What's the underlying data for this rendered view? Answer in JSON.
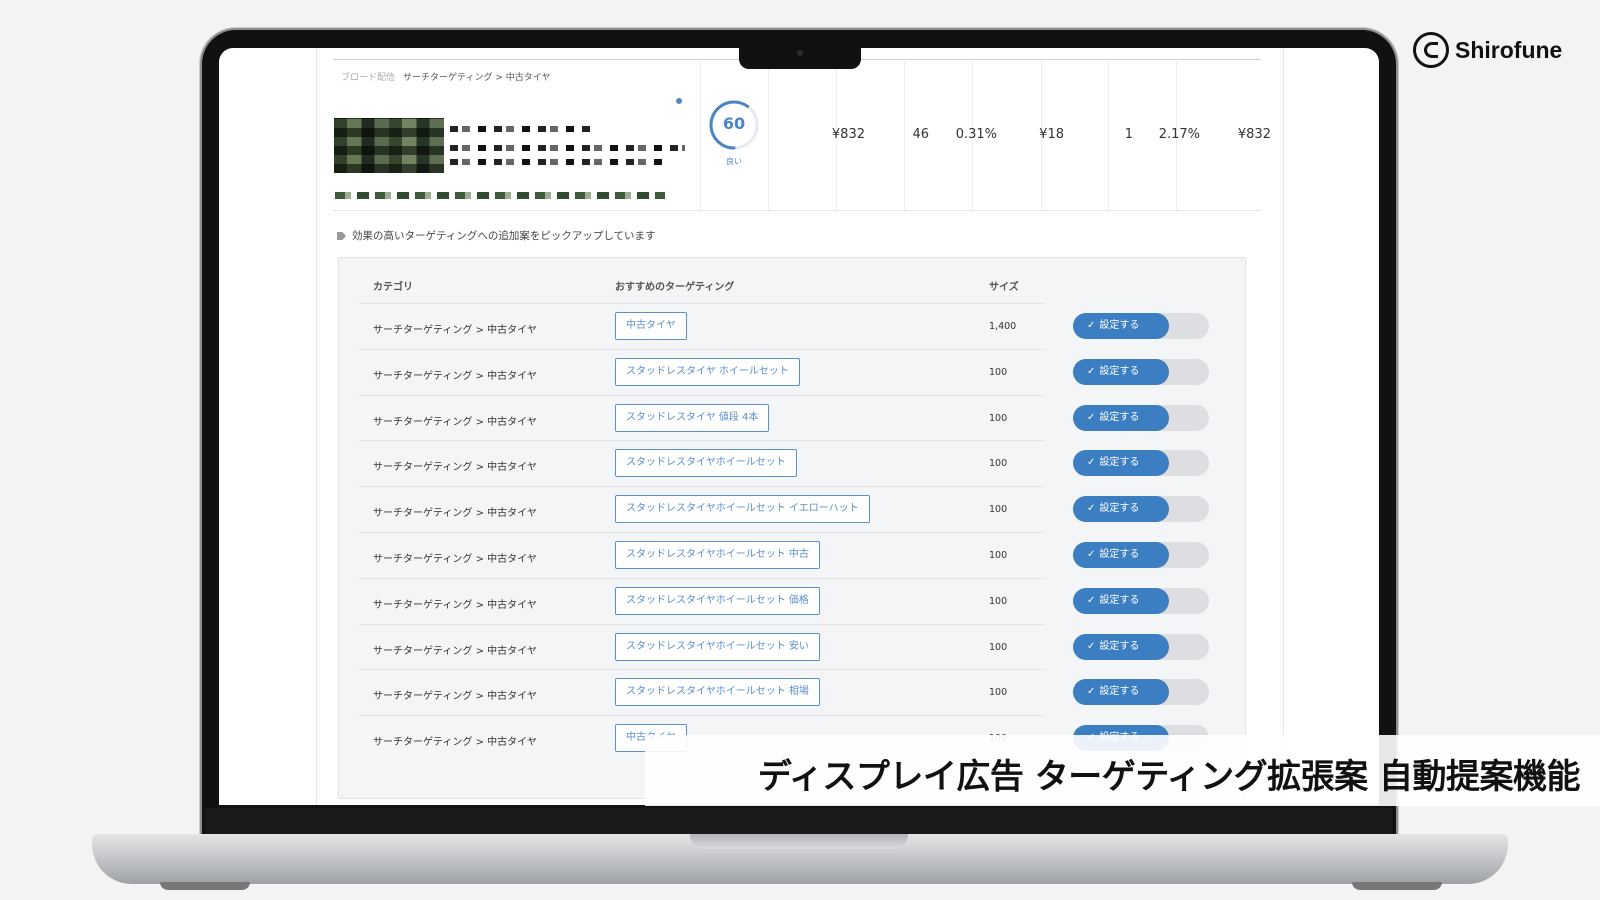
{
  "brand": {
    "name": "Shirofune",
    "logo_icon": "shirofune-logo-icon"
  },
  "caption": "ディスプレイ広告 ターゲティング拡張案 自動提案機能",
  "ad_row": {
    "delivery_label": "ブロード配信",
    "targeting_path": "サーチターゲティング > 中古タイヤ",
    "score": "60",
    "score_label": "良い",
    "metrics": [
      "¥832",
      "46",
      "0.31%",
      "¥18",
      "1",
      "2.17%",
      "¥832"
    ]
  },
  "suggestion_note": "効果の高いターゲティングへの追加案をピックアップしています",
  "table": {
    "headers": {
      "category": "カテゴリ",
      "targeting": "おすすめのターゲティング",
      "size": "サイズ"
    },
    "rows": [
      {
        "category": "サーチターゲティング > 中古タイヤ",
        "keyword": "中古タイヤ",
        "size": "1,400",
        "action": "設定する"
      },
      {
        "category": "サーチターゲティング > 中古タイヤ",
        "keyword": "スタッドレスタイヤ ホイールセット",
        "size": "100",
        "action": "設定する"
      },
      {
        "category": "サーチターゲティング > 中古タイヤ",
        "keyword": "スタッドレスタイヤ 値段 4本",
        "size": "100",
        "action": "設定する"
      },
      {
        "category": "サーチターゲティング > 中古タイヤ",
        "keyword": "スタッドレスタイヤホイールセット",
        "size": "100",
        "action": "設定する"
      },
      {
        "category": "サーチターゲティング > 中古タイヤ",
        "keyword": "スタッドレスタイヤホイールセット イエローハット",
        "size": "100",
        "action": "設定する"
      },
      {
        "category": "サーチターゲティング > 中古タイヤ",
        "keyword": "スタッドレスタイヤホイールセット 中古",
        "size": "100",
        "action": "設定する"
      },
      {
        "category": "サーチターゲティング > 中古タイヤ",
        "keyword": "スタッドレスタイヤホイールセット 価格",
        "size": "100",
        "action": "設定する"
      },
      {
        "category": "サーチターゲティング > 中古タイヤ",
        "keyword": "スタッドレスタイヤホイールセット 安い",
        "size": "100",
        "action": "設定する"
      },
      {
        "category": "サーチターゲティング > 中古タイヤ",
        "keyword": "スタッドレスタイヤホイールセット 相場",
        "size": "100",
        "action": "設定する"
      },
      {
        "category": "サーチターゲティング > 中古タイヤ",
        "keyword": "中古タイヤ",
        "size": "100",
        "action": "設定する"
      }
    ]
  }
}
